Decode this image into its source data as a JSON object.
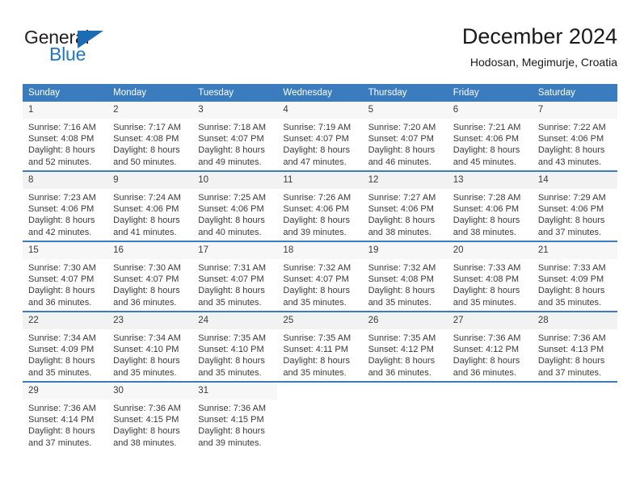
{
  "brand": {
    "name_top": "General",
    "name_bottom": "Blue",
    "accent_color": "#2176c7"
  },
  "header": {
    "title": "December 2024",
    "subtitle": "Hodosan, Megimurje, Croatia"
  },
  "calendar": {
    "header_color": "#3a7cbe",
    "weekday_headers": [
      "Sunday",
      "Monday",
      "Tuesday",
      "Wednesday",
      "Thursday",
      "Friday",
      "Saturday"
    ],
    "weeks": [
      [
        {
          "day": "1",
          "sunrise": "Sunrise: 7:16 AM",
          "sunset": "Sunset: 4:08 PM",
          "daylight1": "Daylight: 8 hours",
          "daylight2": "and 52 minutes."
        },
        {
          "day": "2",
          "sunrise": "Sunrise: 7:17 AM",
          "sunset": "Sunset: 4:08 PM",
          "daylight1": "Daylight: 8 hours",
          "daylight2": "and 50 minutes."
        },
        {
          "day": "3",
          "sunrise": "Sunrise: 7:18 AM",
          "sunset": "Sunset: 4:07 PM",
          "daylight1": "Daylight: 8 hours",
          "daylight2": "and 49 minutes."
        },
        {
          "day": "4",
          "sunrise": "Sunrise: 7:19 AM",
          "sunset": "Sunset: 4:07 PM",
          "daylight1": "Daylight: 8 hours",
          "daylight2": "and 47 minutes."
        },
        {
          "day": "5",
          "sunrise": "Sunrise: 7:20 AM",
          "sunset": "Sunset: 4:07 PM",
          "daylight1": "Daylight: 8 hours",
          "daylight2": "and 46 minutes."
        },
        {
          "day": "6",
          "sunrise": "Sunrise: 7:21 AM",
          "sunset": "Sunset: 4:06 PM",
          "daylight1": "Daylight: 8 hours",
          "daylight2": "and 45 minutes."
        },
        {
          "day": "7",
          "sunrise": "Sunrise: 7:22 AM",
          "sunset": "Sunset: 4:06 PM",
          "daylight1": "Daylight: 8 hours",
          "daylight2": "and 43 minutes."
        }
      ],
      [
        {
          "day": "8",
          "sunrise": "Sunrise: 7:23 AM",
          "sunset": "Sunset: 4:06 PM",
          "daylight1": "Daylight: 8 hours",
          "daylight2": "and 42 minutes."
        },
        {
          "day": "9",
          "sunrise": "Sunrise: 7:24 AM",
          "sunset": "Sunset: 4:06 PM",
          "daylight1": "Daylight: 8 hours",
          "daylight2": "and 41 minutes."
        },
        {
          "day": "10",
          "sunrise": "Sunrise: 7:25 AM",
          "sunset": "Sunset: 4:06 PM",
          "daylight1": "Daylight: 8 hours",
          "daylight2": "and 40 minutes."
        },
        {
          "day": "11",
          "sunrise": "Sunrise: 7:26 AM",
          "sunset": "Sunset: 4:06 PM",
          "daylight1": "Daylight: 8 hours",
          "daylight2": "and 39 minutes."
        },
        {
          "day": "12",
          "sunrise": "Sunrise: 7:27 AM",
          "sunset": "Sunset: 4:06 PM",
          "daylight1": "Daylight: 8 hours",
          "daylight2": "and 38 minutes."
        },
        {
          "day": "13",
          "sunrise": "Sunrise: 7:28 AM",
          "sunset": "Sunset: 4:06 PM",
          "daylight1": "Daylight: 8 hours",
          "daylight2": "and 38 minutes."
        },
        {
          "day": "14",
          "sunrise": "Sunrise: 7:29 AM",
          "sunset": "Sunset: 4:06 PM",
          "daylight1": "Daylight: 8 hours",
          "daylight2": "and 37 minutes."
        }
      ],
      [
        {
          "day": "15",
          "sunrise": "Sunrise: 7:30 AM",
          "sunset": "Sunset: 4:07 PM",
          "daylight1": "Daylight: 8 hours",
          "daylight2": "and 36 minutes."
        },
        {
          "day": "16",
          "sunrise": "Sunrise: 7:30 AM",
          "sunset": "Sunset: 4:07 PM",
          "daylight1": "Daylight: 8 hours",
          "daylight2": "and 36 minutes."
        },
        {
          "day": "17",
          "sunrise": "Sunrise: 7:31 AM",
          "sunset": "Sunset: 4:07 PM",
          "daylight1": "Daylight: 8 hours",
          "daylight2": "and 35 minutes."
        },
        {
          "day": "18",
          "sunrise": "Sunrise: 7:32 AM",
          "sunset": "Sunset: 4:07 PM",
          "daylight1": "Daylight: 8 hours",
          "daylight2": "and 35 minutes."
        },
        {
          "day": "19",
          "sunrise": "Sunrise: 7:32 AM",
          "sunset": "Sunset: 4:08 PM",
          "daylight1": "Daylight: 8 hours",
          "daylight2": "and 35 minutes."
        },
        {
          "day": "20",
          "sunrise": "Sunrise: 7:33 AM",
          "sunset": "Sunset: 4:08 PM",
          "daylight1": "Daylight: 8 hours",
          "daylight2": "and 35 minutes."
        },
        {
          "day": "21",
          "sunrise": "Sunrise: 7:33 AM",
          "sunset": "Sunset: 4:09 PM",
          "daylight1": "Daylight: 8 hours",
          "daylight2": "and 35 minutes."
        }
      ],
      [
        {
          "day": "22",
          "sunrise": "Sunrise: 7:34 AM",
          "sunset": "Sunset: 4:09 PM",
          "daylight1": "Daylight: 8 hours",
          "daylight2": "and 35 minutes."
        },
        {
          "day": "23",
          "sunrise": "Sunrise: 7:34 AM",
          "sunset": "Sunset: 4:10 PM",
          "daylight1": "Daylight: 8 hours",
          "daylight2": "and 35 minutes."
        },
        {
          "day": "24",
          "sunrise": "Sunrise: 7:35 AM",
          "sunset": "Sunset: 4:10 PM",
          "daylight1": "Daylight: 8 hours",
          "daylight2": "and 35 minutes."
        },
        {
          "day": "25",
          "sunrise": "Sunrise: 7:35 AM",
          "sunset": "Sunset: 4:11 PM",
          "daylight1": "Daylight: 8 hours",
          "daylight2": "and 35 minutes."
        },
        {
          "day": "26",
          "sunrise": "Sunrise: 7:35 AM",
          "sunset": "Sunset: 4:12 PM",
          "daylight1": "Daylight: 8 hours",
          "daylight2": "and 36 minutes."
        },
        {
          "day": "27",
          "sunrise": "Sunrise: 7:36 AM",
          "sunset": "Sunset: 4:12 PM",
          "daylight1": "Daylight: 8 hours",
          "daylight2": "and 36 minutes."
        },
        {
          "day": "28",
          "sunrise": "Sunrise: 7:36 AM",
          "sunset": "Sunset: 4:13 PM",
          "daylight1": "Daylight: 8 hours",
          "daylight2": "and 37 minutes."
        }
      ],
      [
        {
          "day": "29",
          "sunrise": "Sunrise: 7:36 AM",
          "sunset": "Sunset: 4:14 PM",
          "daylight1": "Daylight: 8 hours",
          "daylight2": "and 37 minutes."
        },
        {
          "day": "30",
          "sunrise": "Sunrise: 7:36 AM",
          "sunset": "Sunset: 4:15 PM",
          "daylight1": "Daylight: 8 hours",
          "daylight2": "and 38 minutes."
        },
        {
          "day": "31",
          "sunrise": "Sunrise: 7:36 AM",
          "sunset": "Sunset: 4:15 PM",
          "daylight1": "Daylight: 8 hours",
          "daylight2": "and 39 minutes."
        },
        null,
        null,
        null,
        null
      ]
    ]
  }
}
